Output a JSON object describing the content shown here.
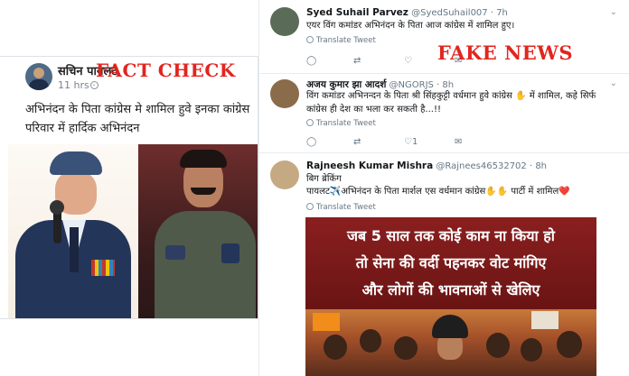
{
  "facebook_post": {
    "author": "सचिन पायलट",
    "time": "11 hrs ·",
    "stamp": "FACT CHECK",
    "text": "अभिनंदन के पिता कांग्रेस मे शामिल हुवे इनका कांग्रेस परिवार में हार्दिक अभिनंदन"
  },
  "stamp_fake": "FAKE NEWS",
  "tweets": [
    {
      "name": "Syed Suhail Parvez",
      "handle": "@SyedSuhail007 · 7h",
      "text": "एयर विंग कमांडर अभिनंदन के पिता आज कांग्रेस में शामिल हुए।",
      "translate": "Translate Tweet",
      "likes": ""
    },
    {
      "name": "अजय कुमार झा आदर्श",
      "handle": "@NGORJS · 8h",
      "text": "विंग कमांडर अभिनन्दन के पिता श्री सिंहकुट्टी वर्धमान हुवे कांग्रेस ✋ में शामिल, कहे सिर्फ कांग्रेस ही देश का भला कर सकती है...!!",
      "translate": "Translate Tweet",
      "likes": "1"
    },
    {
      "name": "Rajneesh Kumar Mishra",
      "handle": "@Rajnees46532702 · 8h",
      "text_line1": "बिग ब्रेकिंग",
      "text_line2": "पायलट✈️अभिनंदन के पिता मार्शल एस वर्धमान कांग्रेस✋✋ पार्टी में शामिल❤️",
      "translate": "Translate Tweet"
    }
  ],
  "poster": {
    "line1": "जब 5 साल तक कोई काम ना किया हो",
    "line2": "तो सेना की वर्दी पहनकर वोट मांगिए",
    "line3": "और लोगों की भावनाओं से खेलिए"
  },
  "icons": {
    "reply": "reply-icon",
    "retweet": "retweet-icon",
    "like": "heart-icon",
    "message": "message-icon"
  }
}
